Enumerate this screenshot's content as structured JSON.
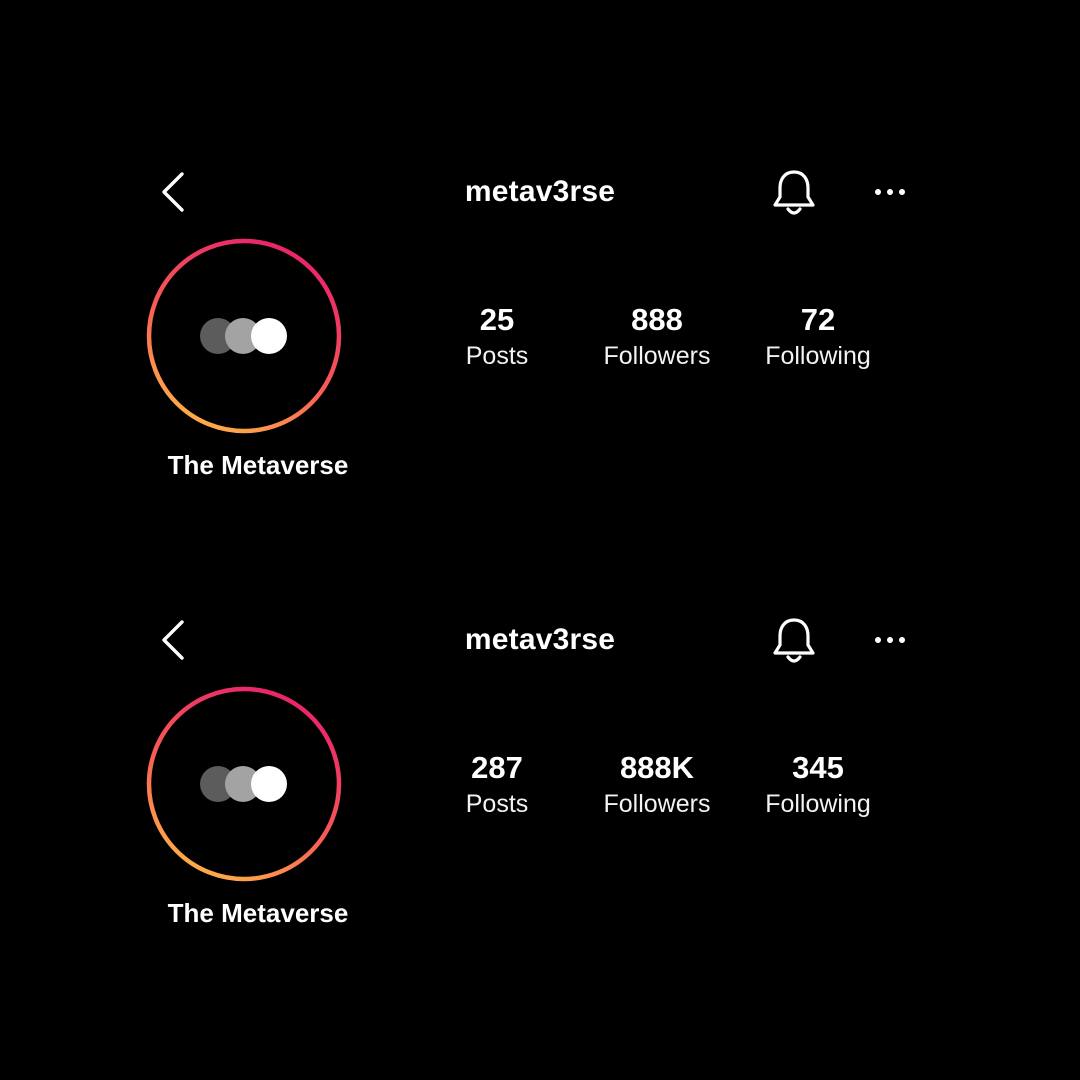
{
  "colors": {
    "background": "#000000",
    "text": "#ffffff",
    "ring_gradient_top": "#e8206e",
    "ring_gradient_bottom": "#ffb347"
  },
  "icons": {
    "back": "chevron-left-icon",
    "notifications": "bell-icon",
    "more": "more-horizontal-icon",
    "avatar": "three-circles-logo"
  },
  "profiles": [
    {
      "username": "metav3rse",
      "display_name": "The Metaverse",
      "stats": {
        "posts": {
          "value": "25",
          "label": "Posts"
        },
        "followers": {
          "value": "888",
          "label": "Followers"
        },
        "following": {
          "value": "72",
          "label": "Following"
        }
      }
    },
    {
      "username": "metav3rse",
      "display_name": "The Metaverse",
      "stats": {
        "posts": {
          "value": "287",
          "label": "Posts"
        },
        "followers": {
          "value": "888K",
          "label": "Followers"
        },
        "following": {
          "value": "345",
          "label": "Following"
        }
      }
    }
  ]
}
